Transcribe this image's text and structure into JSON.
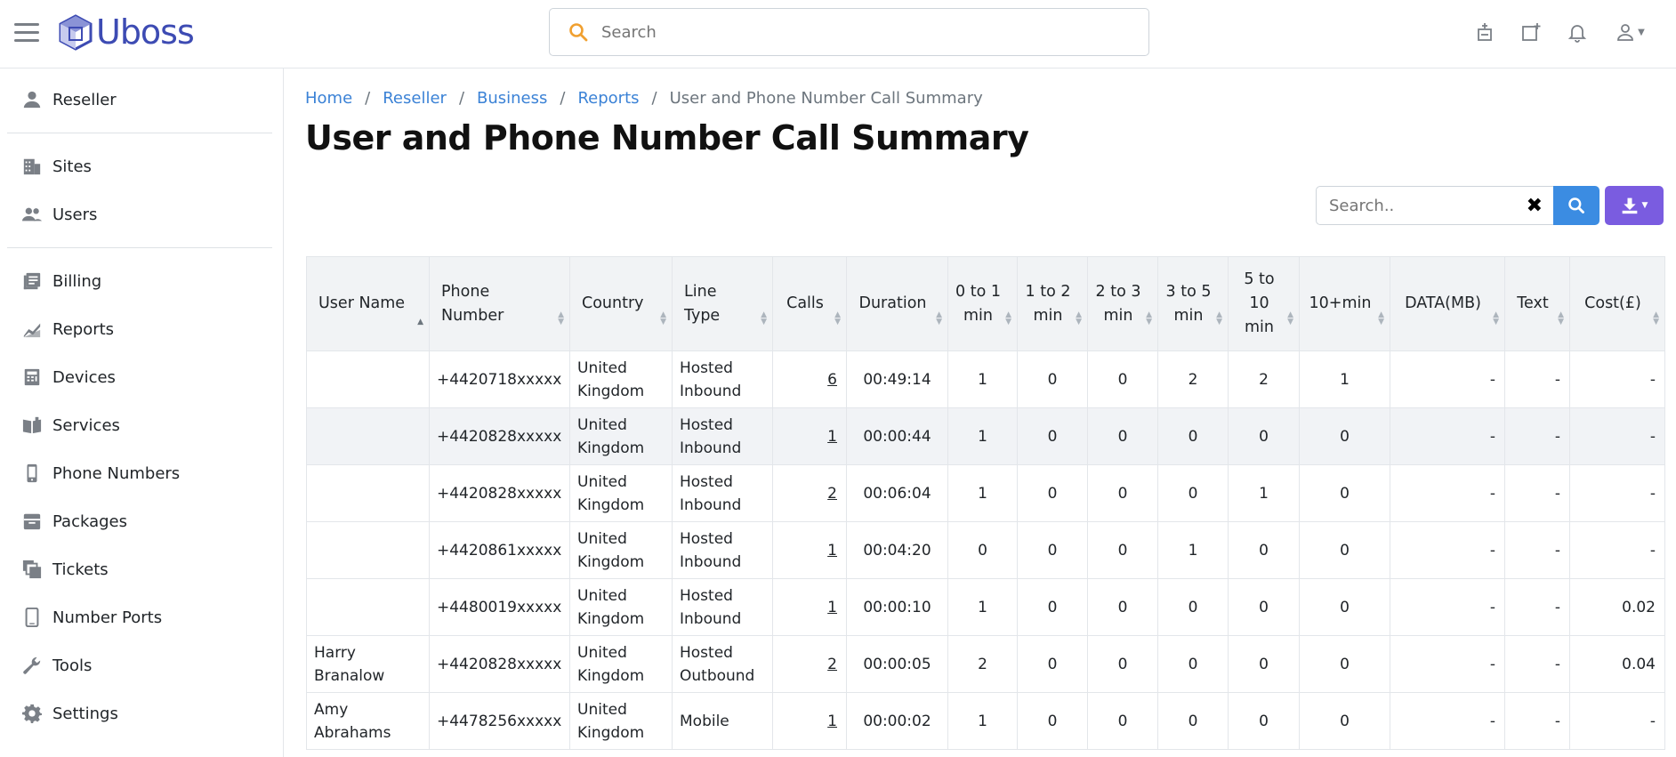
{
  "app": {
    "logo_text": "Uboss",
    "brand_color": "#3d4bb3",
    "accent_color": "#3b8ce2",
    "download_color": "#7a5ce0"
  },
  "topbar": {
    "search_placeholder": "Search",
    "icons": [
      "menu-icon",
      "add-user-icon",
      "add-window-icon",
      "bell-icon",
      "user-icon"
    ]
  },
  "sidebar": {
    "items": [
      {
        "label": "Reseller",
        "icon": "person-icon"
      },
      {
        "label": "Sites",
        "icon": "building-icon"
      },
      {
        "label": "Users",
        "icon": "users-icon"
      },
      {
        "label": "Billing",
        "icon": "billing-icon"
      },
      {
        "label": "Reports",
        "icon": "chart-icon"
      },
      {
        "label": "Devices",
        "icon": "devices-icon"
      },
      {
        "label": "Services",
        "icon": "book-icon"
      },
      {
        "label": "Phone Numbers",
        "icon": "phone-icon"
      },
      {
        "label": "Packages",
        "icon": "package-icon"
      },
      {
        "label": "Tickets",
        "icon": "tickets-icon"
      },
      {
        "label": "Number Ports",
        "icon": "mobile-icon"
      },
      {
        "label": "Tools",
        "icon": "wrench-icon"
      },
      {
        "label": "Settings",
        "icon": "gear-icon"
      }
    ]
  },
  "breadcrumb": {
    "items": [
      "Home",
      "Reseller",
      "Business",
      "Reports"
    ],
    "current": "User and Phone Number Call Summary"
  },
  "page": {
    "title": "User and Phone Number Call Summary",
    "search_placeholder": "Search..",
    "clear_symbol": "✖"
  },
  "table": {
    "headers": [
      "User Name",
      "Phone Number",
      "Country",
      "Line Type",
      "Calls",
      "Duration",
      "0 to 1 min",
      "1 to 2 min",
      "2 to 3 min",
      "3 to 5 min",
      "5 to 10 min",
      "10+min",
      "DATA(MB)",
      "Text",
      "Cost(£)"
    ],
    "rows": [
      {
        "user": "",
        "phone": "+4420718xxxxx",
        "country": "United Kingdom",
        "line_type": "Hosted Inbound",
        "calls": "6",
        "duration": "00:49:14",
        "b1": "1",
        "b2": "0",
        "b3": "0",
        "b4": "2",
        "b5": "2",
        "b6": "1",
        "data": "-",
        "text": "-",
        "cost": "-"
      },
      {
        "user": "",
        "phone": "+4420828xxxxx",
        "country": "United Kingdom",
        "line_type": "Hosted Inbound",
        "calls": "1",
        "duration": "00:00:44",
        "b1": "1",
        "b2": "0",
        "b3": "0",
        "b4": "0",
        "b5": "0",
        "b6": "0",
        "data": "-",
        "text": "-",
        "cost": "-"
      },
      {
        "user": "",
        "phone": "+4420828xxxxx",
        "country": "United Kingdom",
        "line_type": "Hosted Inbound",
        "calls": "2",
        "duration": "00:06:04",
        "b1": "1",
        "b2": "0",
        "b3": "0",
        "b4": "0",
        "b5": "1",
        "b6": "0",
        "data": "-",
        "text": "-",
        "cost": "-"
      },
      {
        "user": "",
        "phone": "+4420861xxxxx",
        "country": "United Kingdom",
        "line_type": "Hosted Inbound",
        "calls": "1",
        "duration": "00:04:20",
        "b1": "0",
        "b2": "0",
        "b3": "0",
        "b4": "1",
        "b5": "0",
        "b6": "0",
        "data": "-",
        "text": "-",
        "cost": "-"
      },
      {
        "user": "",
        "phone": "+4480019xxxxx",
        "country": "United Kingdom",
        "line_type": "Hosted Inbound",
        "calls": "1",
        "duration": "00:00:10",
        "b1": "1",
        "b2": "0",
        "b3": "0",
        "b4": "0",
        "b5": "0",
        "b6": "0",
        "data": "-",
        "text": "-",
        "cost": "0.02"
      },
      {
        "user": "Harry Branalow",
        "phone": "+4420828xxxxx",
        "country": "United Kingdom",
        "line_type": "Hosted Outbound",
        "calls": "2",
        "duration": "00:00:05",
        "b1": "2",
        "b2": "0",
        "b3": "0",
        "b4": "0",
        "b5": "0",
        "b6": "0",
        "data": "-",
        "text": "-",
        "cost": "0.04"
      },
      {
        "user": "Amy Abrahams",
        "phone": "+4478256xxxxx",
        "country": "United Kingdom",
        "line_type": "Mobile",
        "calls": "1",
        "duration": "00:00:02",
        "b1": "1",
        "b2": "0",
        "b3": "0",
        "b4": "0",
        "b5": "0",
        "b6": "0",
        "data": "-",
        "text": "-",
        "cost": "-"
      }
    ]
  }
}
